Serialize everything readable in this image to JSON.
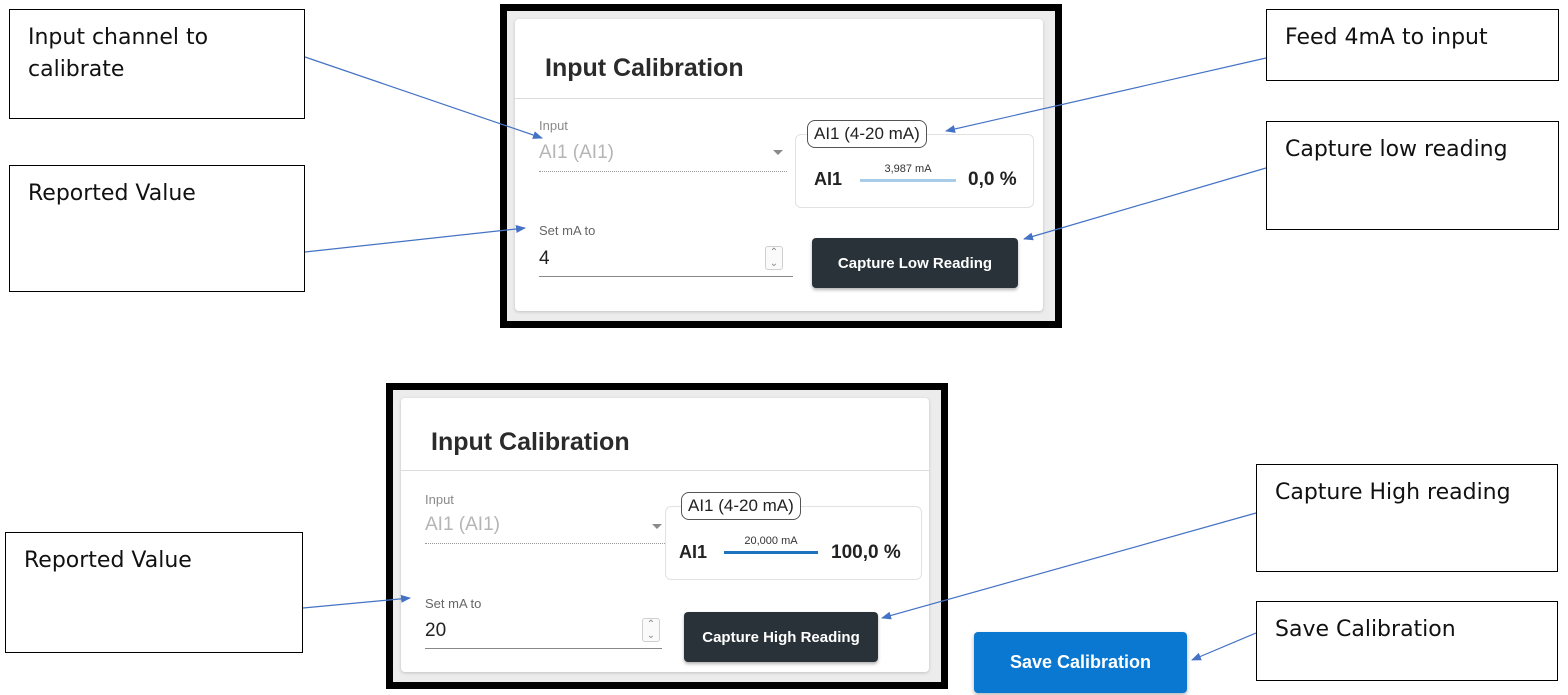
{
  "callouts": {
    "input_channel": "Input channel to calibrate",
    "reported_value_1": "Reported Value",
    "feed_4ma": "Feed 4mA to input",
    "capture_low": "Capture low reading",
    "reported_value_2": "Reported Value",
    "capture_high": "Capture High reading",
    "save_calibration": "Save Calibration"
  },
  "panel_low": {
    "title": "Input Calibration",
    "input_label": "Input",
    "input_value": "AI1 (AI1)",
    "ai_tag": "AI1 (4-20 mA)",
    "ai_name": "AI1",
    "ai_ma": "3,987 mA",
    "ai_percent": "0,0 %",
    "ai_level": 0.0,
    "set_label": "Set mA to",
    "set_value": "4",
    "button": "Capture Low Reading"
  },
  "panel_high": {
    "title": "Input Calibration",
    "input_label": "Input",
    "input_value": "AI1 (AI1)",
    "ai_tag": "AI1 (4-20 mA)",
    "ai_name": "AI1",
    "ai_ma": "20,000 mA",
    "ai_percent": "100,0 %",
    "ai_level": 1.0,
    "set_label": "Set mA to",
    "set_value": "20",
    "button": "Capture High Reading"
  },
  "save_button": "Save Calibration",
  "colors": {
    "low_bar": "#a9cde8",
    "high_bar": "#1e73be",
    "arrow": "#4472c4",
    "button_dark": "#283238",
    "button_blue": "#0a78d1"
  }
}
